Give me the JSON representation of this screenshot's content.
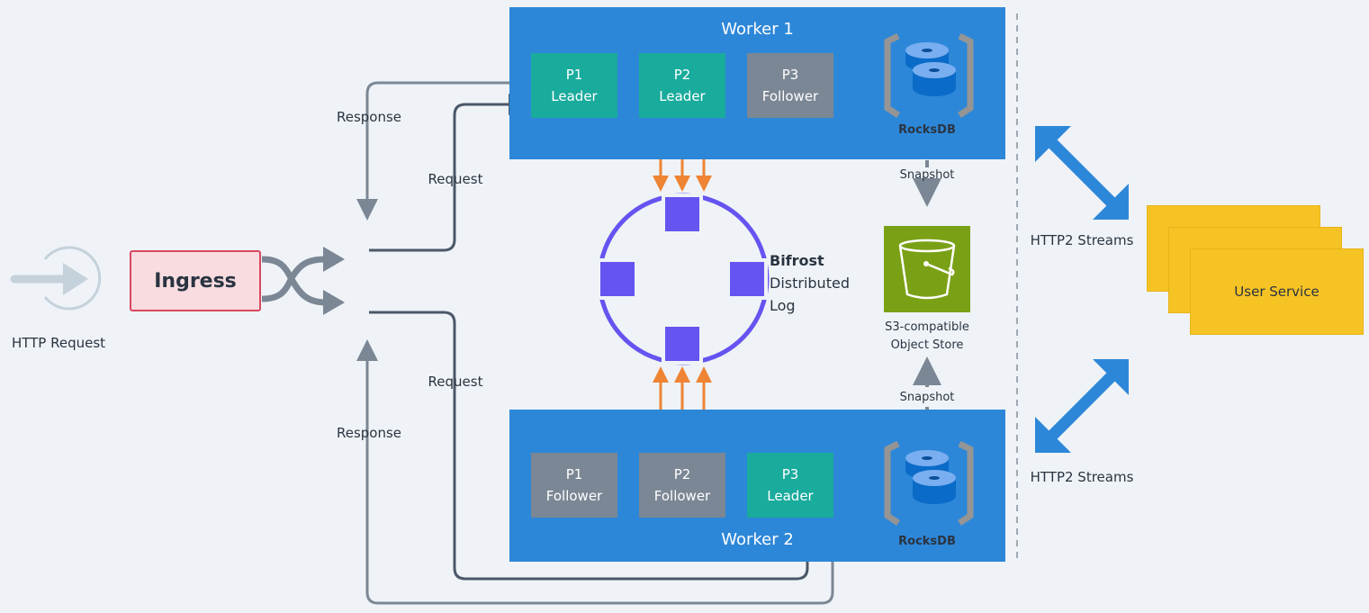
{
  "ingress": {
    "label": "Ingress",
    "input_label": "HTTP Request"
  },
  "worker1": {
    "title": "Worker 1",
    "partitions": [
      {
        "id": "P1",
        "role": "Leader"
      },
      {
        "id": "P2",
        "role": "Leader"
      },
      {
        "id": "P3",
        "role": "Follower"
      }
    ],
    "store": "RocksDB"
  },
  "worker2": {
    "title": "Worker 2",
    "partitions": [
      {
        "id": "P1",
        "role": "Follower"
      },
      {
        "id": "P2",
        "role": "Follower"
      },
      {
        "id": "P3",
        "role": "Leader"
      }
    ],
    "store": "RocksDB"
  },
  "flows": {
    "response_top": "Response",
    "request_top": "Request",
    "request_bottom": "Request",
    "response_bottom": "Response"
  },
  "bifrost": {
    "name": "Bifrost",
    "line2": "Distributed",
    "line3": "Log"
  },
  "snapshot": {
    "top": "Snapshot",
    "bottom": "Snapshot"
  },
  "object_store": {
    "line1": "S3-compatible",
    "line2": "Object Store"
  },
  "streams": {
    "top": "HTTP2 Streams",
    "bottom": "HTTP2 Streams"
  },
  "user_service": {
    "label": "User Service"
  },
  "colors": {
    "worker": "#2D87D8",
    "leader": "#19AB9C",
    "follower": "#7B8794",
    "log": "#6554F0",
    "replication": "#EE8434",
    "s3": "#7AA116",
    "service": "#F6C324",
    "ingress_fill": "#F8DCE0",
    "ingress_border": "#D9485F"
  }
}
